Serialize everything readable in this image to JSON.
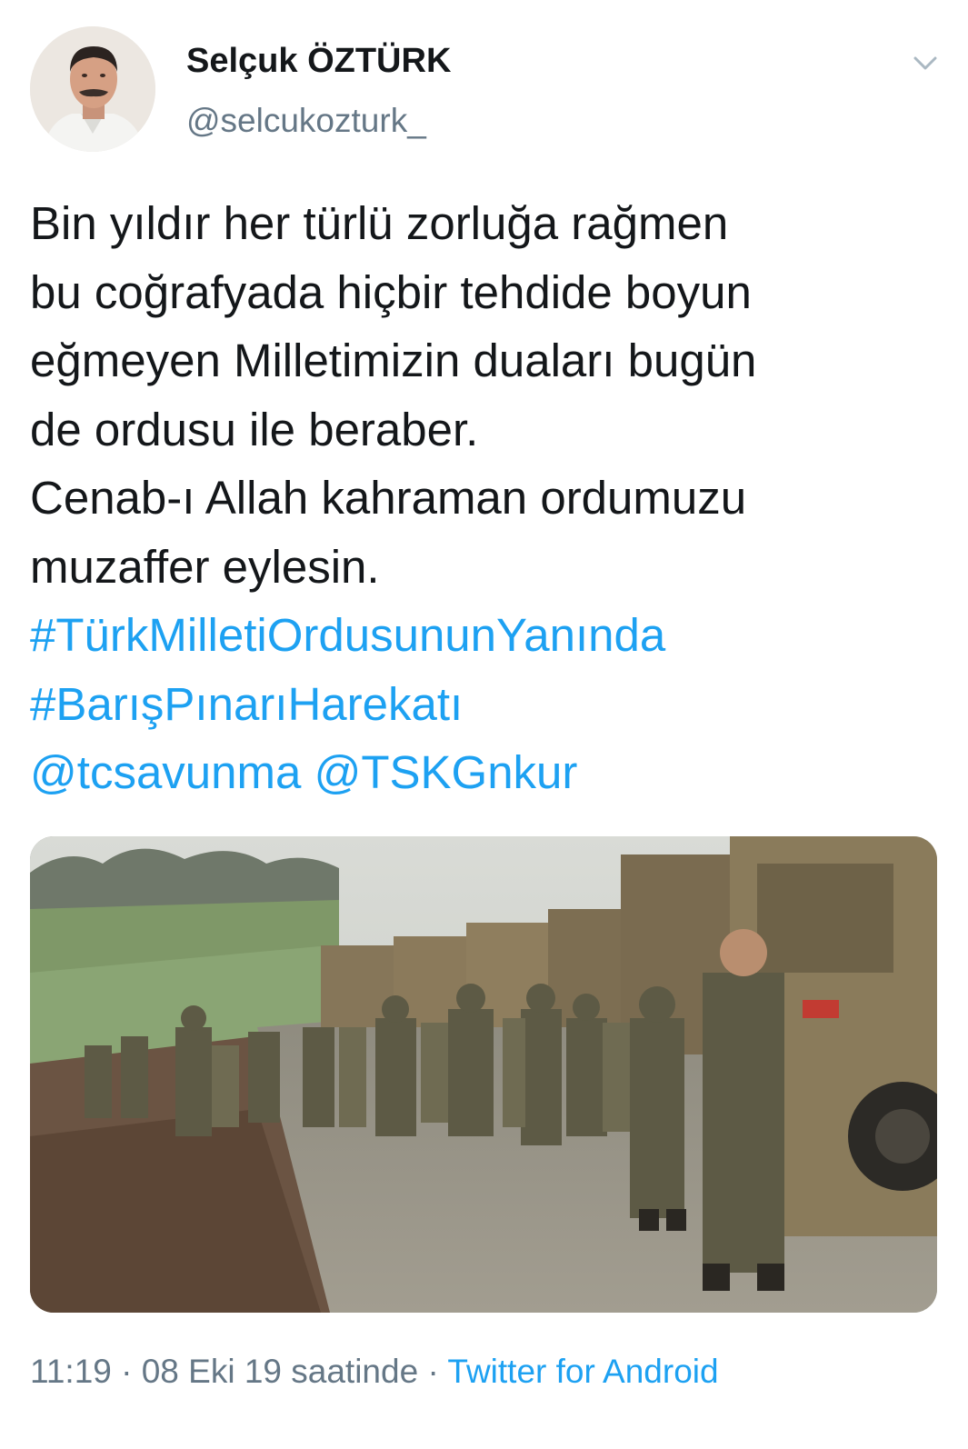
{
  "tweet": {
    "author": {
      "name": "Selçuk ÖZTÜRK",
      "handle": "@selcukozturk_"
    },
    "text_lines": [
      "Bin yıldır her türlü zorluğa rağmen",
      "bu coğrafyada hiçbir tehdide boyun",
      "eğmeyen Milletimizin duaları bugün",
      "de ordusu ile beraber.",
      "Cenab-ı Allah kahraman ordumuzu",
      "muzaffer eylesin."
    ],
    "hashtags": [
      "#TürkMilletiOrdusununYanında",
      "#BarışPınarıHarekatı"
    ],
    "mentions": [
      "@tcsavunma",
      "@TSKGnkur"
    ],
    "timestamp": "11:19 · 08 Eki 19 saatinde",
    "separator": " · ",
    "source": "Twitter for Android",
    "icons": {
      "more": "chevron-down-icon"
    },
    "colors": {
      "link": "#1da1f2",
      "secondary_text": "#657786",
      "primary_text": "#14171a"
    }
  }
}
